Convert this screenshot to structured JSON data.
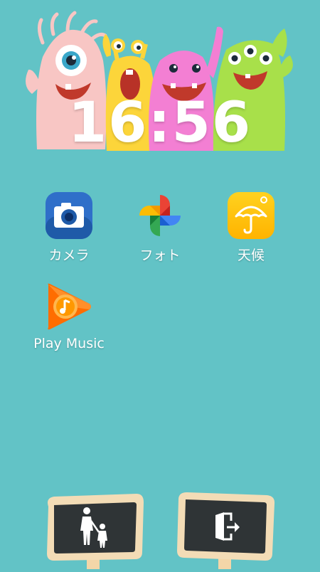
{
  "clock": {
    "time": "16:56"
  },
  "apps": [
    {
      "label": "カメラ",
      "icon": "camera-icon"
    },
    {
      "label": "フォト",
      "icon": "photos-pinwheel-icon"
    },
    {
      "label": "天候",
      "icon": "weather-umbrella-icon"
    },
    {
      "label": "Play Music",
      "icon": "play-music-icon"
    }
  ],
  "bottom_buttons": [
    {
      "icon": "parent-child-icon"
    },
    {
      "icon": "exit-door-icon"
    }
  ],
  "colors": {
    "background": "#62c3c6",
    "monster_pink": "#f8c6c4",
    "monster_yellow": "#fcd53a",
    "monster_magenta": "#f37fd3",
    "monster_green": "#a8e04a"
  }
}
